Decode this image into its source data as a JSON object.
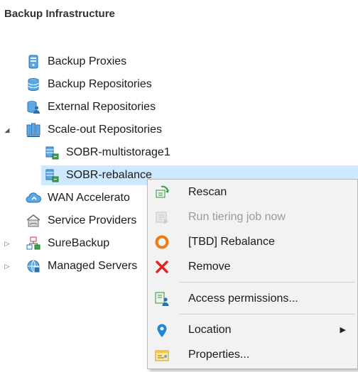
{
  "header": {
    "title": "Backup Infrastructure"
  },
  "tree": {
    "backup_proxies": "Backup Proxies",
    "backup_repositories": "Backup Repositories",
    "external_repositories": "External Repositories",
    "scaleout_repositories": "Scale-out Repositories",
    "sobr_multistorage": "SOBR-multistorage1",
    "sobr_rebalance": "SOBR-rebalance",
    "wan_accelerators": "WAN Accelerato",
    "service_providers": "Service Providers",
    "surebackup": "SureBackup",
    "managed_servers": "Managed Servers"
  },
  "context_menu": {
    "rescan": "Rescan",
    "run_tiering": "Run tiering job now",
    "rebalance": "[TBD] Rebalance",
    "remove": "Remove",
    "access_permissions": "Access permissions...",
    "location": "Location",
    "properties": "Properties..."
  },
  "colors": {
    "selection": "#cde8ff",
    "menu_background": "#f2f2f2",
    "remove_red": "#e02020",
    "rebalance_orange": "#f07a10",
    "location_blue": "#1e88d8"
  }
}
